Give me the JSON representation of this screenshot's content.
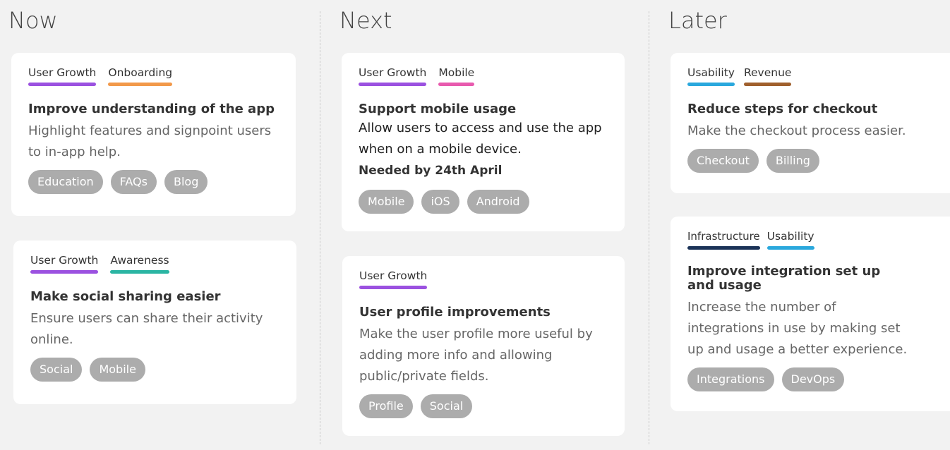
{
  "colors": {
    "background": "#f2f2f2",
    "card": "#ffffff",
    "tag": "#acacac",
    "user_growth": "#9b51e0",
    "onboarding": "#f2994a",
    "awareness": "#2bb5a3",
    "mobile": "#e85aae",
    "usability": "#2aa8dd",
    "revenue": "#a0602d",
    "infrastructure": "#1b3358"
  },
  "columns": [
    {
      "title": "Now",
      "cards": [
        {
          "themes": [
            {
              "label": "User Growth",
              "color": "#9b51e0"
            },
            {
              "label": "Onboarding",
              "color": "#f2994a"
            }
          ],
          "title": "Improve understanding of the app",
          "description": "Highlight features and signpoint users to in-app help.",
          "tags": [
            "Education",
            "FAQs",
            "Blog"
          ]
        },
        {
          "themes": [
            {
              "label": "User Growth",
              "color": "#9b51e0"
            },
            {
              "label": "Awareness",
              "color": "#2bb5a3"
            }
          ],
          "title": "Make social sharing easier",
          "description": "Ensure users can share their activity online.",
          "tags": [
            "Social",
            "Mobile"
          ]
        }
      ]
    },
    {
      "title": "Next",
      "cards": [
        {
          "themes": [
            {
              "label": "User Growth",
              "color": "#9b51e0"
            },
            {
              "label": "Mobile",
              "color": "#e85aae"
            }
          ],
          "title": "Support mobile usage",
          "description": "Allow users to access and use the app when on a mobile device.",
          "note": "Needed by 24th April",
          "tags": [
            "Mobile",
            "iOS",
            "Android"
          ]
        },
        {
          "themes": [
            {
              "label": "User Growth",
              "color": "#9b51e0"
            }
          ],
          "title": "User profile improvements",
          "description": "Make the user profile more useful by adding more info and allowing public/private fields.",
          "tags": [
            "Profile",
            "Social"
          ]
        }
      ]
    },
    {
      "title": "Later",
      "cards": [
        {
          "themes": [
            {
              "label": "Usability",
              "color": "#2aa8dd"
            },
            {
              "label": "Revenue",
              "color": "#a0602d"
            }
          ],
          "title": "Reduce steps for checkout",
          "description": "Make the checkout process easier.",
          "tags": [
            "Checkout",
            "Billing"
          ]
        },
        {
          "themes": [
            {
              "label": "Infrastructure",
              "color": "#1b3358"
            },
            {
              "label": "Usability",
              "color": "#2aa8dd"
            }
          ],
          "title": "Improve integration set up and usage",
          "description": "Increase the number of integrations in use by making set up and usage a better experience.",
          "tags": [
            "Integrations",
            "DevOps"
          ]
        }
      ]
    }
  ]
}
